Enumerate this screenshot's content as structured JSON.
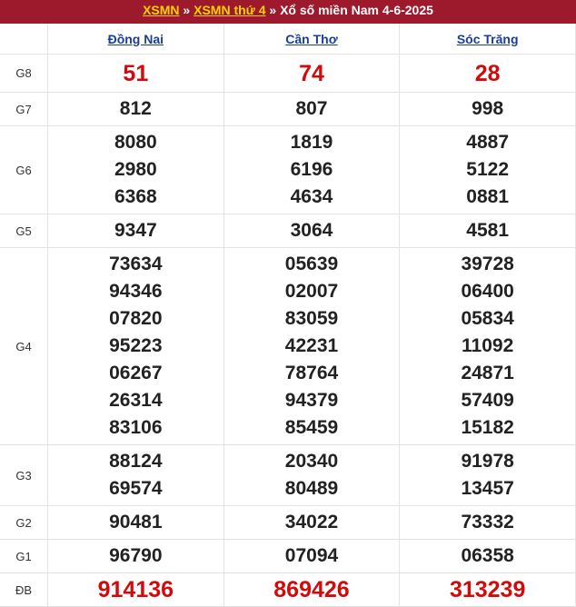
{
  "header": {
    "link1": "XSMN",
    "sep1": " » ",
    "link2": "XSMN thứ 4",
    "sep2": " » ",
    "title": "Xổ số miền Nam 4-6-2025"
  },
  "provinces": [
    "Đồng Nai",
    "Cần Thơ",
    "Sóc Trăng"
  ],
  "rows": [
    {
      "label": "G8",
      "values": [
        [
          "51"
        ],
        [
          "74"
        ],
        [
          "28"
        ]
      ]
    },
    {
      "label": "G7",
      "values": [
        [
          "812"
        ],
        [
          "807"
        ],
        [
          "998"
        ]
      ]
    },
    {
      "label": "G6",
      "values": [
        [
          "8080",
          "2980",
          "6368"
        ],
        [
          "1819",
          "6196",
          "4634"
        ],
        [
          "4887",
          "5122",
          "0881"
        ]
      ]
    },
    {
      "label": "G5",
      "values": [
        [
          "9347"
        ],
        [
          "3064"
        ],
        [
          "4581"
        ]
      ]
    },
    {
      "label": "G4",
      "values": [
        [
          "73634",
          "94346",
          "07820",
          "95223",
          "06267",
          "26314",
          "83106"
        ],
        [
          "05639",
          "02007",
          "83059",
          "42231",
          "78764",
          "94379",
          "85459"
        ],
        [
          "39728",
          "06400",
          "05834",
          "11092",
          "24871",
          "57409",
          "15182"
        ]
      ]
    },
    {
      "label": "G3",
      "values": [
        [
          "88124",
          "69574"
        ],
        [
          "20340",
          "80489"
        ],
        [
          "91978",
          "13457"
        ]
      ]
    },
    {
      "label": "G2",
      "values": [
        [
          "90481"
        ],
        [
          "34022"
        ],
        [
          "73332"
        ]
      ]
    },
    {
      "label": "G1",
      "values": [
        [
          "96790"
        ],
        [
          "07094"
        ],
        [
          "06358"
        ]
      ]
    },
    {
      "label": "ĐB",
      "values": [
        [
          "914136"
        ],
        [
          "869426"
        ],
        [
          "313239"
        ]
      ]
    }
  ]
}
